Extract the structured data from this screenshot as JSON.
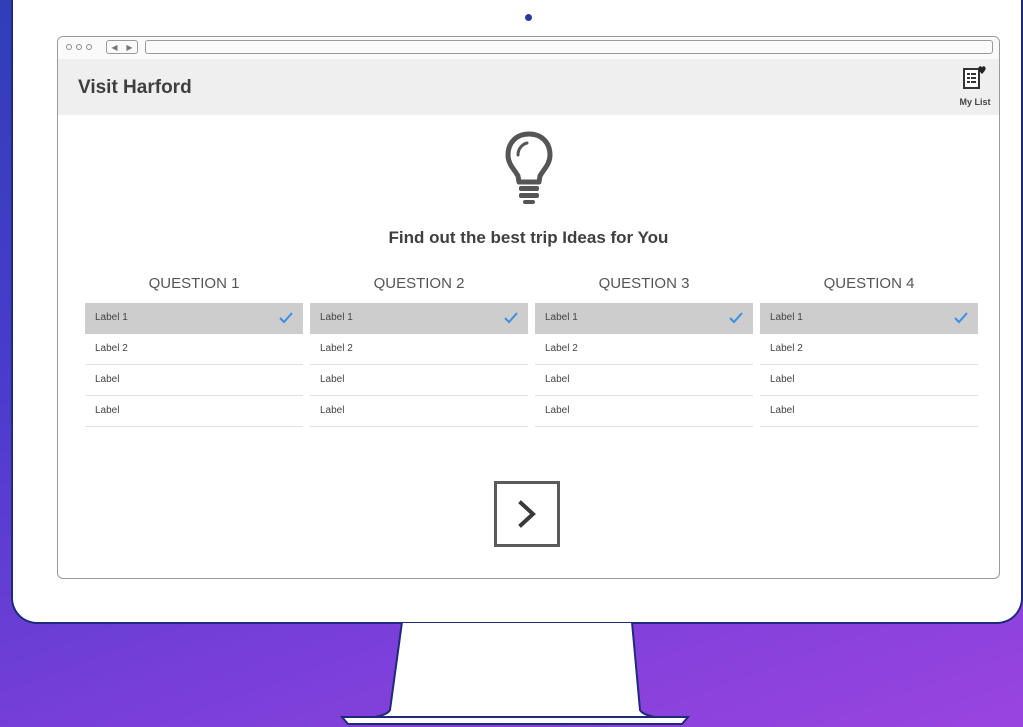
{
  "header": {
    "site_title": "Visit Harford",
    "my_list_label": "My List"
  },
  "main": {
    "heading": "Find out the best trip Ideas for You",
    "questions": [
      {
        "title": "QUESTION 1",
        "options": [
          "Label 1",
          "Label 2",
          "Label",
          "Label"
        ],
        "selected": 0
      },
      {
        "title": "QUESTION 2",
        "options": [
          "Label 1",
          "Label 2",
          "Label",
          "Label"
        ],
        "selected": 0
      },
      {
        "title": "QUESTION 3",
        "options": [
          "Label 1",
          "Label 2",
          "Label",
          "Label"
        ],
        "selected": 0
      },
      {
        "title": "QUESTION 4",
        "options": [
          "Label 1",
          "Label 2",
          "Label",
          "Label"
        ],
        "selected": 0
      }
    ],
    "next_icon": "chevron-right-icon"
  },
  "icons": {
    "hero": "lightbulb-icon",
    "my_list": "list-heart-icon",
    "check": "checkmark-icon"
  },
  "colors": {
    "background_start": "#2f3fb8",
    "background_end": "#9a44e0",
    "check": "#3b8fe0",
    "selected_row": "#cdcdcd",
    "header_bg": "#efefef"
  }
}
